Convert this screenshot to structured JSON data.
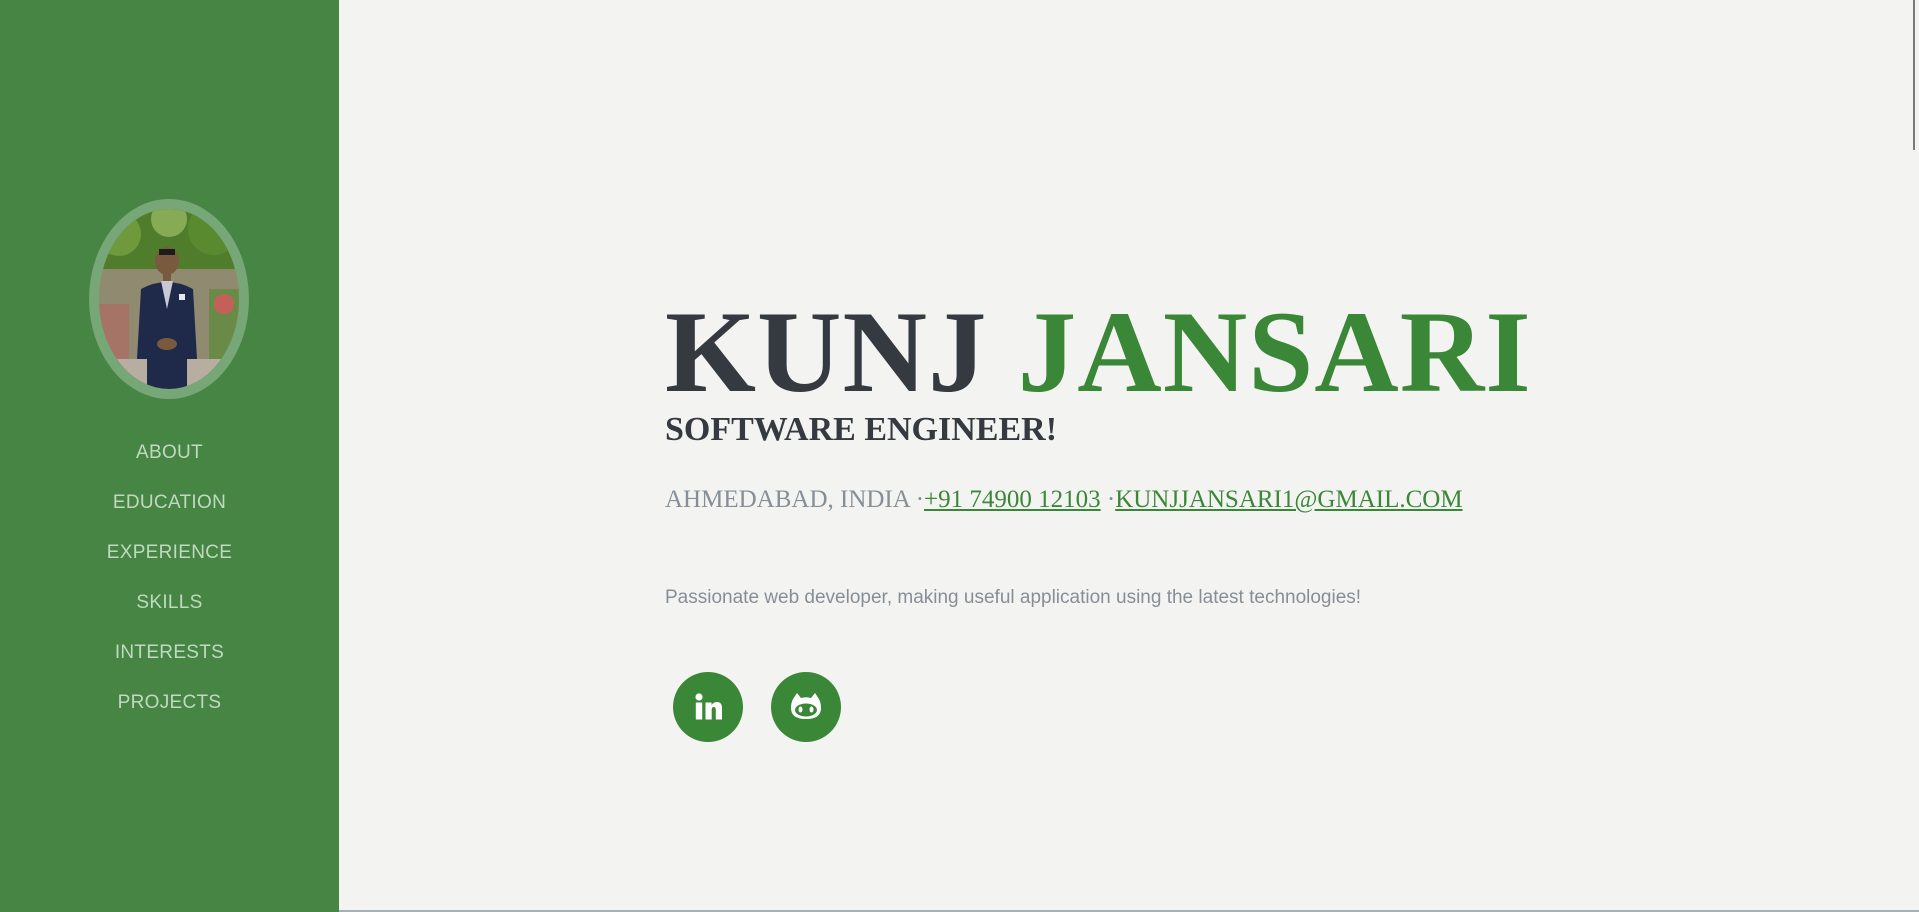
{
  "sidebar": {
    "avatar_alt": "profile photo",
    "nav": [
      {
        "label": "ABOUT"
      },
      {
        "label": "EDUCATION"
      },
      {
        "label": "EXPERIENCE"
      },
      {
        "label": "SKILLS"
      },
      {
        "label": "INTERESTS"
      },
      {
        "label": "PROJECTS"
      }
    ]
  },
  "about": {
    "first_name": "KUNJ",
    "last_name": "JANSARI",
    "subheading": "SOFTWARE ENGINEER!",
    "location": "AHMEDABAD, INDIA",
    "separator": "·",
    "phone": "+91 74900 12103",
    "email": "KUNJJANSARI1@GMAIL.COM",
    "lead": "Passionate web developer, making useful application using the latest technologies!"
  },
  "social": [
    {
      "icon": "linkedin-icon"
    },
    {
      "icon": "github-icon"
    }
  ],
  "colors": {
    "sidebar_bg": "#468544",
    "accent": "#3b8738",
    "page_bg": "#f3f4f2",
    "heading_dark": "#343a40",
    "muted_text": "#868e96",
    "nav_text": "#c0d9bf"
  }
}
